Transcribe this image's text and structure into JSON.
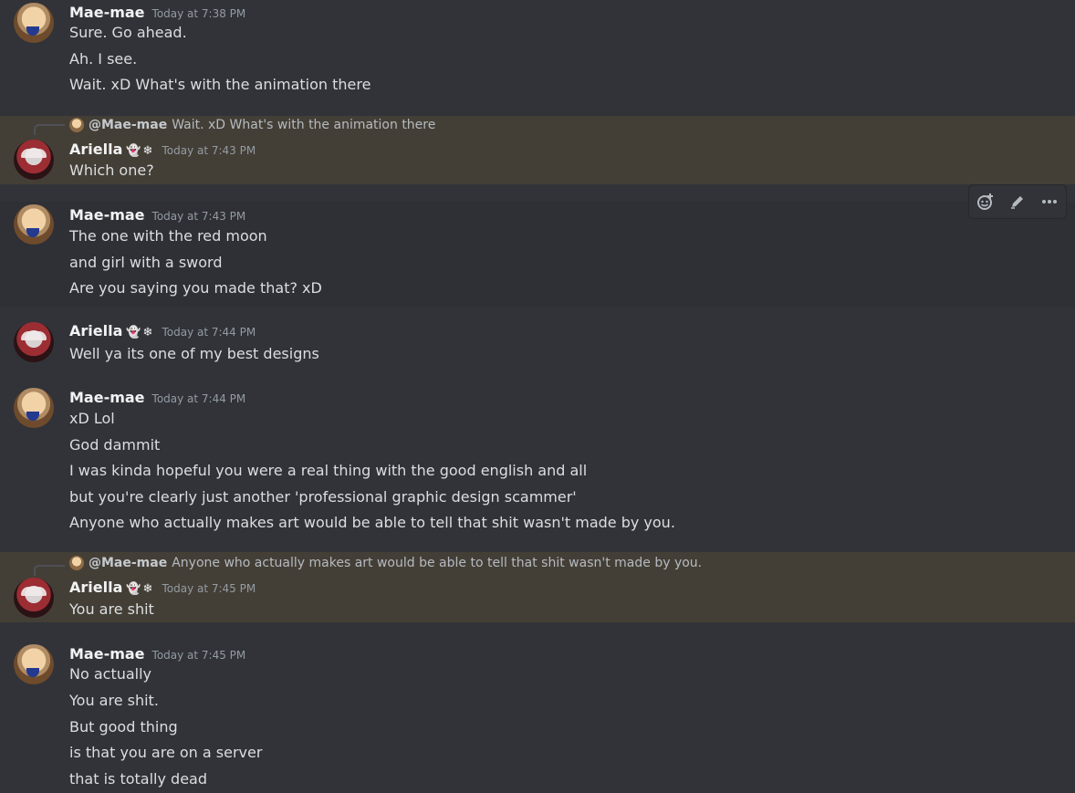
{
  "messages": [
    {
      "author": "Mae-mae",
      "time": "Today at 7:38 PM",
      "lines": [
        "Sure. Go ahead.",
        "Ah. I see.",
        "Wait. xD What's with the animation there"
      ]
    },
    {
      "author": "Ariella",
      "badges": "👻❄",
      "time": "Today at 7:43 PM",
      "reply": {
        "mention": "@Mae-mae",
        "text": "Wait. xD What's with the animation there"
      },
      "lines": [
        "Which one?"
      ]
    },
    {
      "author": "Mae-mae",
      "time": "Today at 7:43 PM",
      "lines": [
        "The one with the red moon",
        "and girl with a sword",
        "Are you saying you made that? xD"
      ]
    },
    {
      "author": "Ariella",
      "badges": "👻❄",
      "time": "Today at 7:44 PM",
      "lines": [
        "Well ya its one of my best designs"
      ]
    },
    {
      "author": "Mae-mae",
      "time": "Today at 7:44 PM",
      "lines": [
        "xD Lol",
        "God dammit",
        "I was kinda hopeful you were a real thing with the good english and all",
        "but you're clearly just another 'professional graphic design scammer'",
        "Anyone who actually makes art would be able to tell that shit wasn't made by you."
      ]
    },
    {
      "author": "Ariella",
      "badges": "👻❄",
      "time": "Today at 7:45 PM",
      "reply": {
        "mention": "@Mae-mae",
        "text": "Anyone who actually makes art would be able to tell that shit wasn't made by you."
      },
      "lines": [
        "You are shit"
      ]
    },
    {
      "author": "Mae-mae",
      "time": "Today at 7:45 PM",
      "lines": [
        "No actually",
        "You are shit.",
        "But good thing",
        "is that you are on a server",
        "that is totally dead"
      ]
    }
  ],
  "toolbar": {
    "icons": [
      "add-reaction-icon",
      "edit-icon",
      "more-icon"
    ]
  }
}
